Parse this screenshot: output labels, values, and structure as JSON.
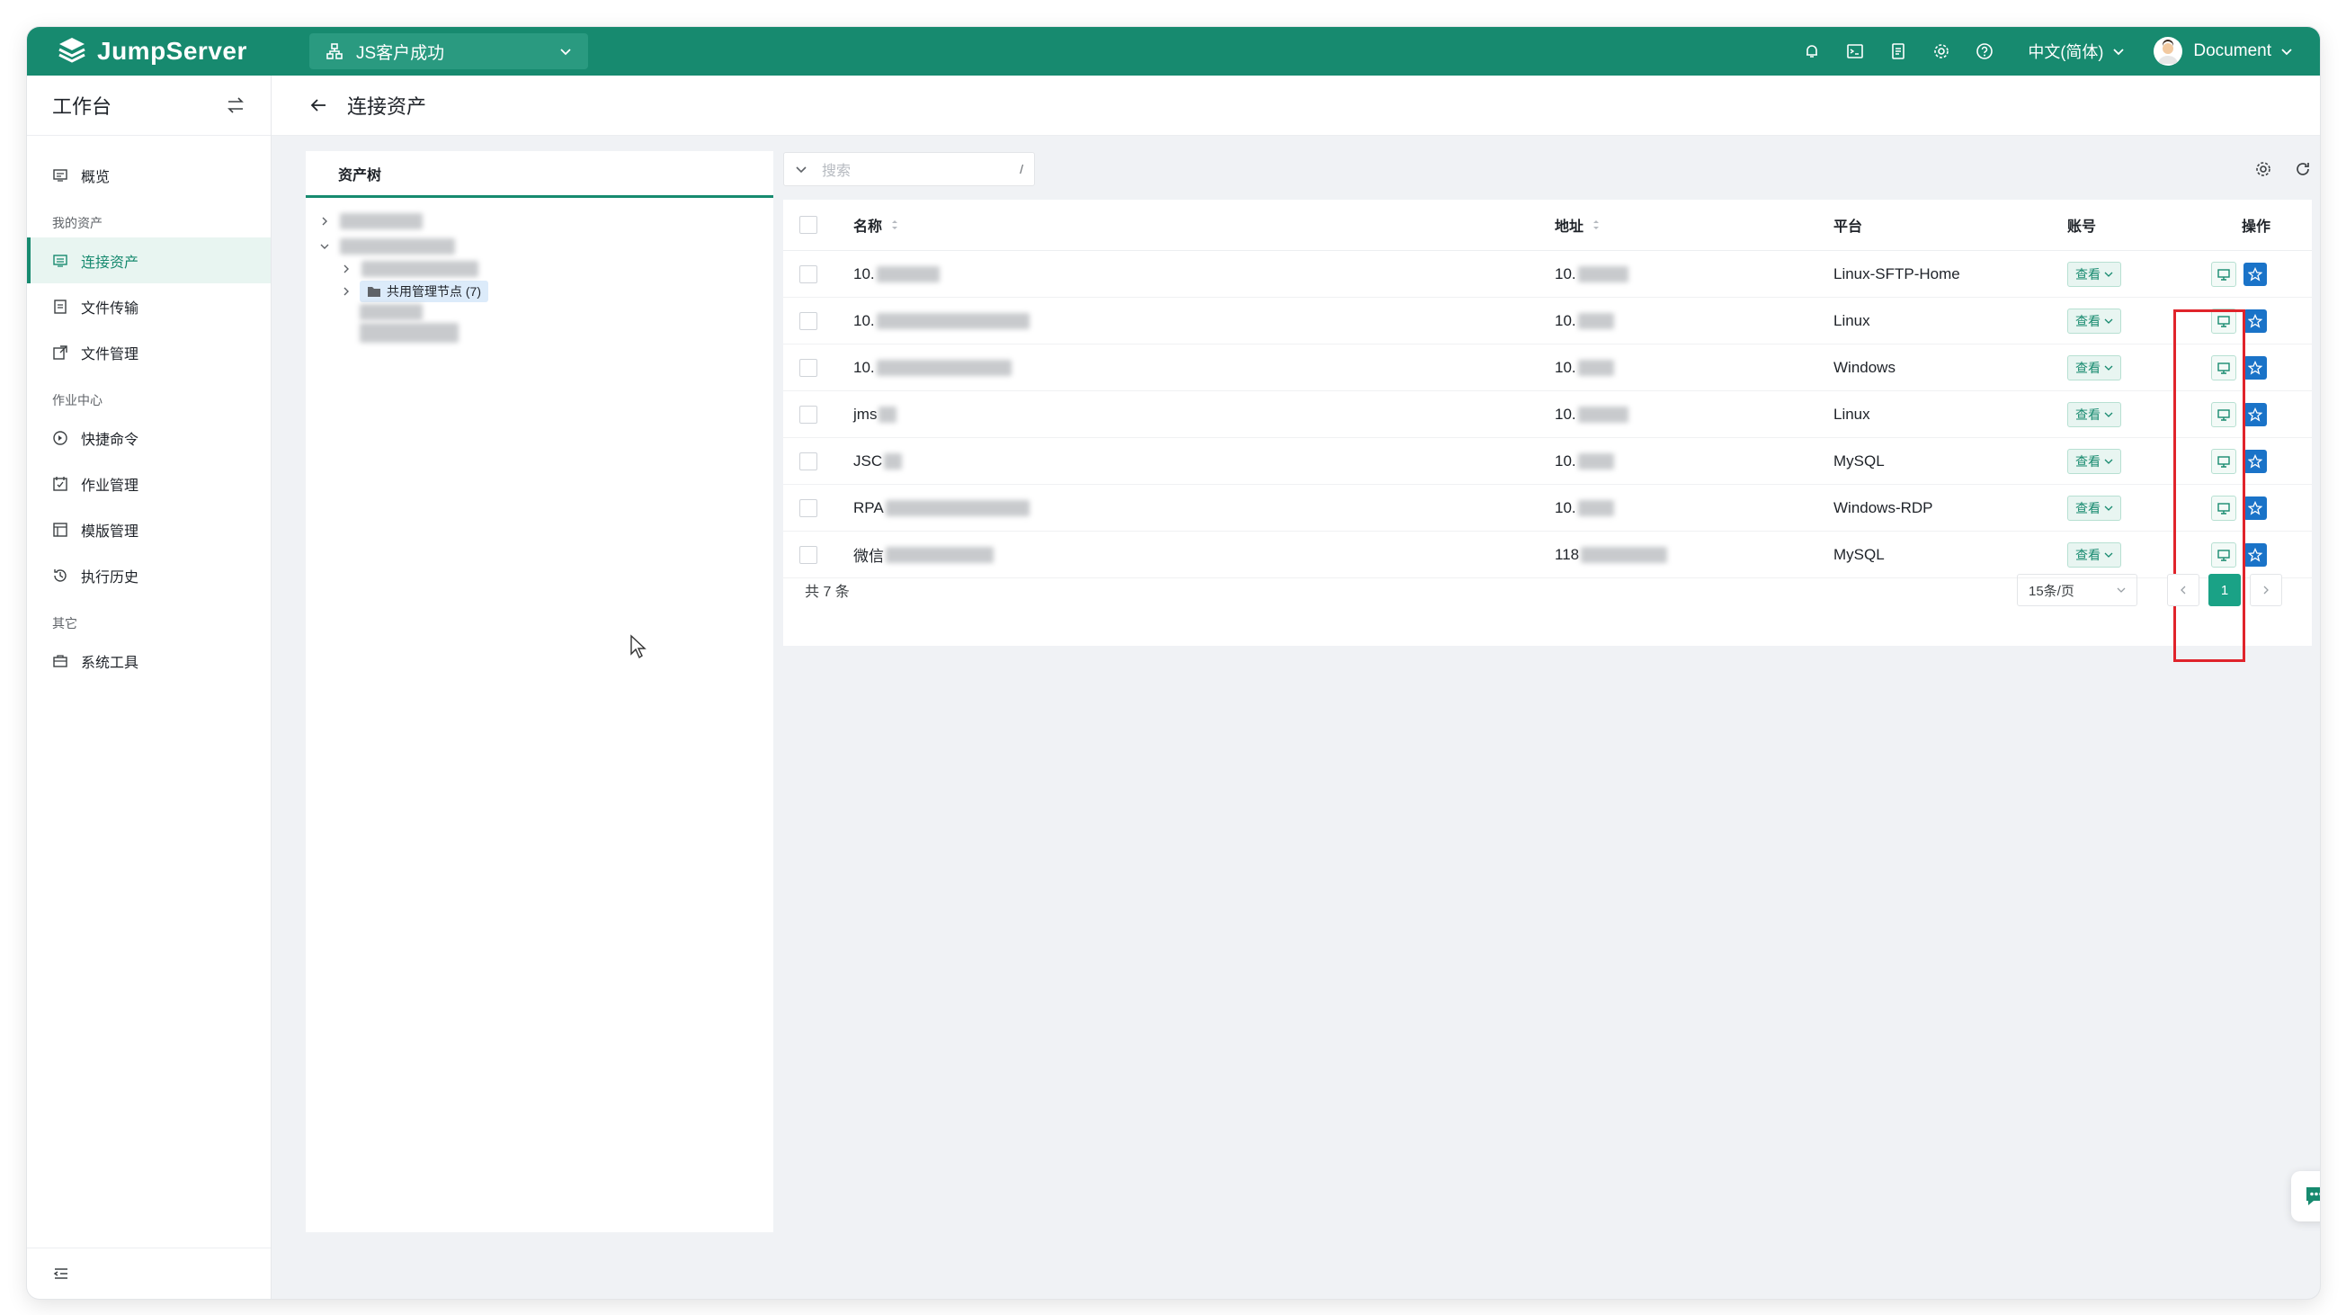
{
  "app": {
    "brand": "JumpServer",
    "org": "JS客户成功"
  },
  "topbar": {
    "icons": [
      "bell-icon",
      "terminal-icon",
      "document-icon",
      "gear-icon",
      "help-icon"
    ],
    "language": "中文(简体)",
    "user": "Document"
  },
  "sidebar": {
    "title": "工作台",
    "items": [
      {
        "label": "概览",
        "icon": "overview-icon"
      },
      {
        "group": "我的资产"
      },
      {
        "label": "连接资产",
        "icon": "connect-icon",
        "active": true
      },
      {
        "label": "文件传输",
        "icon": "file-transfer-icon"
      },
      {
        "label": "文件管理",
        "icon": "file-manage-icon"
      },
      {
        "group": "作业中心"
      },
      {
        "label": "快捷命令",
        "icon": "quick-command-icon"
      },
      {
        "label": "作业管理",
        "icon": "job-manage-icon"
      },
      {
        "label": "模版管理",
        "icon": "template-icon"
      },
      {
        "label": "执行历史",
        "icon": "history-icon"
      },
      {
        "group": "其它"
      },
      {
        "label": "系统工具",
        "icon": "toolbox-icon"
      }
    ]
  },
  "page": {
    "title": "连接资产"
  },
  "tree": {
    "tab": "资产树",
    "shared_node": "共用管理节点 (7)"
  },
  "search": {
    "placeholder": "搜索",
    "shortcut": "/"
  },
  "table": {
    "columns": {
      "name": "名称",
      "address": "地址",
      "platform": "平台",
      "account": "账号",
      "actions": "操作"
    },
    "rows": [
      {
        "name": "10.",
        "address": "10.",
        "platform": "Linux-SFTP-Home",
        "account": "查看"
      },
      {
        "name": "10.",
        "address": "10.",
        "platform": "Linux",
        "account": "查看"
      },
      {
        "name": "10.",
        "address": "10.",
        "platform": "Windows",
        "account": "查看"
      },
      {
        "name": "jms",
        "address": "10.",
        "platform": "Linux",
        "account": "查看"
      },
      {
        "name": "JSC",
        "address": "10.",
        "platform": "MySQL",
        "account": "查看"
      },
      {
        "name": "RPA",
        "address": "10.",
        "platform": "Windows-RDP",
        "account": "查看"
      },
      {
        "name": "微信",
        "address": "118",
        "platform": "MySQL",
        "account": "查看"
      }
    ],
    "total": "共 7 条",
    "page_size": "15条/页",
    "current_page": "1"
  },
  "colors": {
    "brand": "#178a6f",
    "highlight": "#e0242b",
    "favorite": "#1a73c8"
  }
}
